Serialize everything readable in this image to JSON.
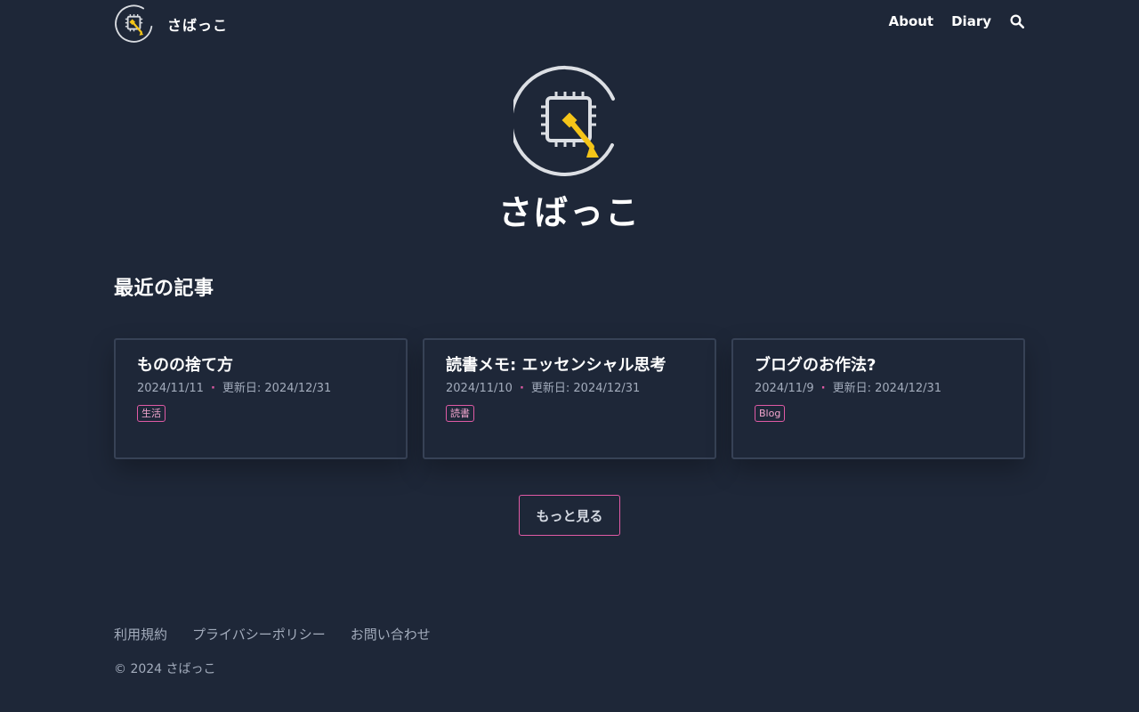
{
  "site": {
    "name": "さばっこ"
  },
  "nav": {
    "items": [
      {
        "label": "About"
      },
      {
        "label": "Diary"
      }
    ],
    "search_icon": "search-icon"
  },
  "hero": {
    "logo_icon": "chip-pin-logo",
    "name": "さばっこ"
  },
  "recent": {
    "heading": "最近の記事",
    "posts": [
      {
        "title": "ものの捨て方",
        "date": "2024/11/11",
        "separator": "·",
        "updated": "更新日: 2024/12/31",
        "tag": "生活"
      },
      {
        "title": "読書メモ: エッセンシャル思考",
        "date": "2024/11/10",
        "separator": "·",
        "updated": "更新日: 2024/12/31",
        "tag": "読書"
      },
      {
        "title": "ブログのお作法?",
        "date": "2024/11/9",
        "separator": "·",
        "updated": "更新日: 2024/12/31",
        "tag": "Blog"
      }
    ],
    "more_label": "もっと見る"
  },
  "footer": {
    "links": [
      {
        "label": "利用規約"
      },
      {
        "label": "プライバシーポリシー"
      },
      {
        "label": "お問い合わせ"
      }
    ],
    "copyright": "© 2024 さばっこ"
  },
  "colors": {
    "background": "#1e2738",
    "accent": "#e05aa5",
    "logo_yellow": "#f5c518",
    "text_muted": "#a3acbc"
  }
}
